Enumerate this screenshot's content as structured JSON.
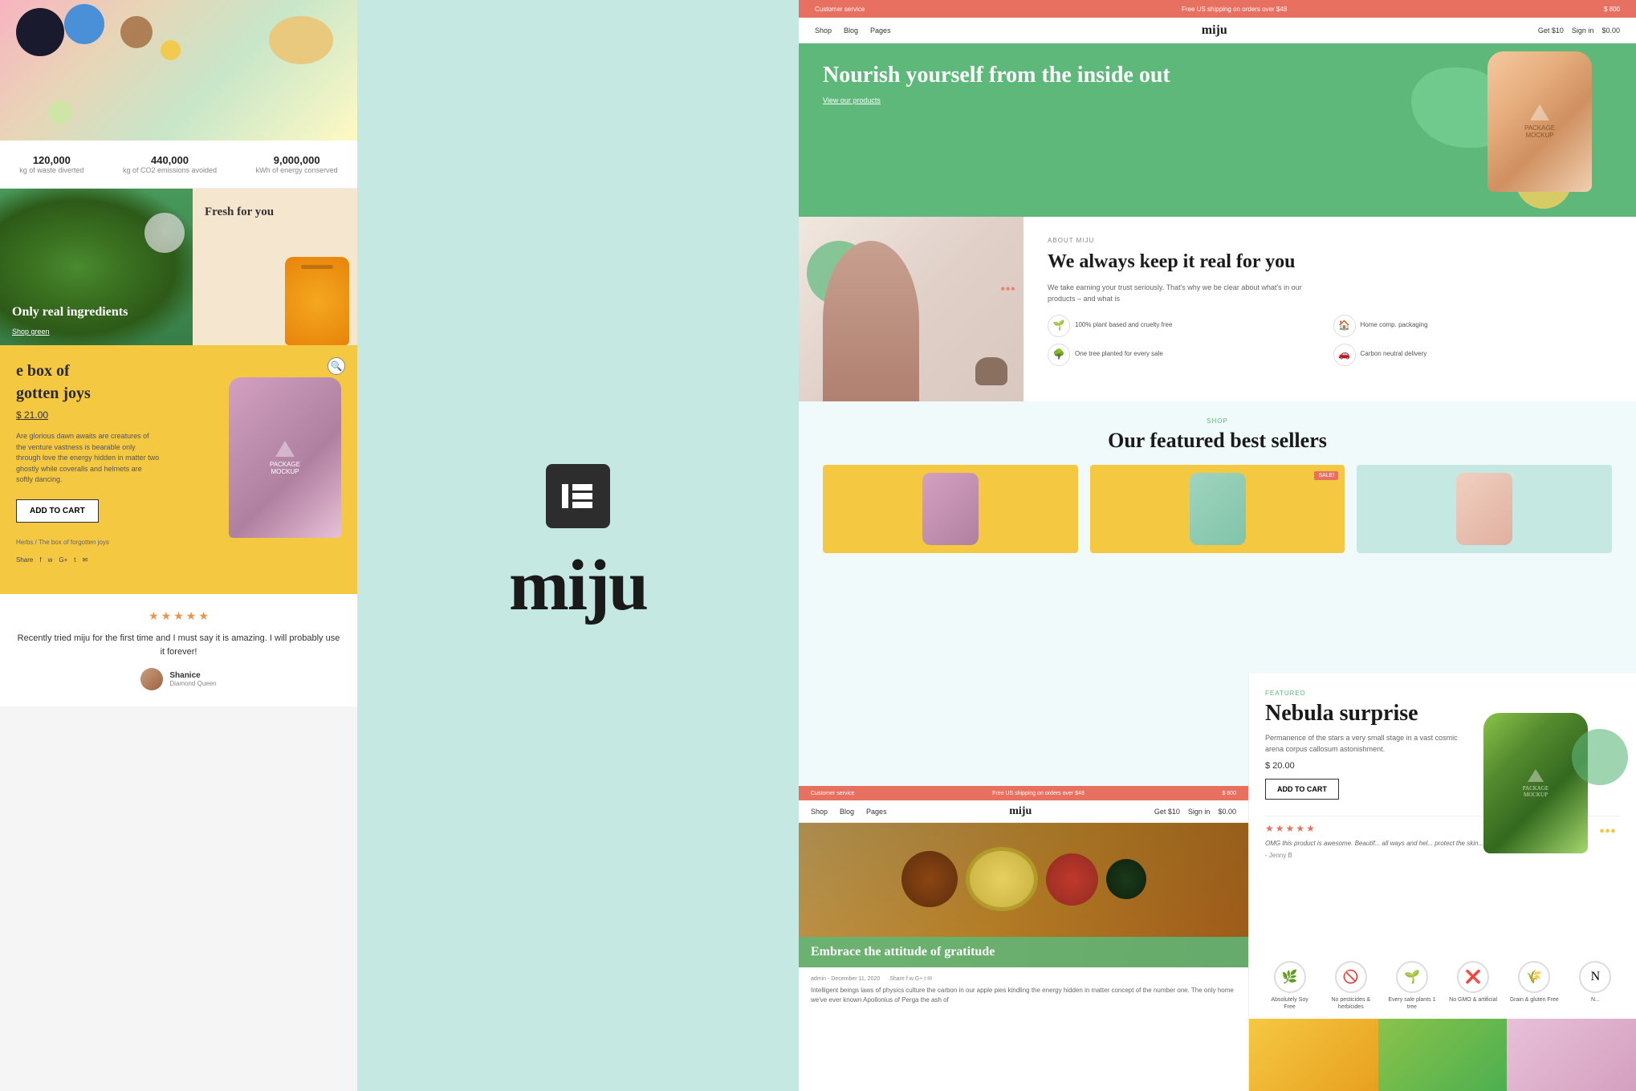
{
  "center": {
    "logo": "miju",
    "elementor_icon": "E"
  },
  "left": {
    "stats": [
      {
        "number": "120,000",
        "label": "kg of waste diverted"
      },
      {
        "number": "440,000",
        "label": "kg of CO2 emissions avoided"
      },
      {
        "number": "9,000,000",
        "label": "kWh of energy conserved"
      }
    ],
    "green_panel": {
      "text": "Only real ingredients",
      "shop_link": "Shop green"
    },
    "cream_panel": {
      "text": "Fresh for you"
    },
    "product": {
      "title": "e box of",
      "subtitle": "gotten joys",
      "price": "$ 21.00",
      "description": "Are glorious dawn awaits are creatures of the venture vastness is bearable only through love the energy hidden in matter two ghostly while coveralls and helmets are softly dancing.",
      "add_to_cart": "ADD TO CART"
    },
    "breadcrumb": "Herbs / The box of forgotten joys",
    "social_label": "Share",
    "review": {
      "text": "Recently tried miju for the first time and I must say it is amazing. I will probably use it forever!",
      "reviewer_name": "Shanice",
      "reviewer_title": "Diamond Queen"
    }
  },
  "right": {
    "top_nav_bar": {
      "left": "Customer service",
      "center": "Free US shipping on orders over $48",
      "right": "$ 800"
    },
    "nav": {
      "links": [
        "Shop",
        "Blog",
        "Pages"
      ],
      "logo": "miju",
      "right_items": [
        "Get $10",
        "Sign in",
        "$0.00"
      ]
    },
    "hero": {
      "heading": "Nourish yourself from the inside out",
      "link": "View our products"
    },
    "about": {
      "label": "ABOUT MIJU",
      "heading": "We always keep it real for you",
      "desc": "We take earning your trust seriously. That's why we be clear about what's in our products – and what is",
      "features": [
        {
          "icon": "🌱",
          "text": "100% plant based and cruelty free"
        },
        {
          "icon": "🏠",
          "text": "Home comp. packaging"
        },
        {
          "icon": "🌳",
          "text": "One tree planted for every sale"
        },
        {
          "icon": "🚗",
          "text": "Carbon neutral delivery"
        }
      ]
    },
    "sellers": {
      "label": "SHOP",
      "heading": "Our featured best sellers"
    },
    "featured": {
      "label": "FEATURED",
      "title": "Nebula surprise",
      "desc": "Permanence of the stars a very small stage in a vast cosmic arena corpus callosum astonishment.",
      "price": "$ 20.00",
      "add_to_cart": "ADD TO CART",
      "stars": 5,
      "review": "OMG this product is awesome. Beautif... all ways and hel... protect the skin... I am so happy wi... purchase:",
      "reviewer": "- Jenny B"
    },
    "icons": [
      {
        "icon": "🌿",
        "label": "Absolutely Soy Free"
      },
      {
        "icon": "🚫",
        "label": "No pesticides & herbicides"
      },
      {
        "icon": "🌱",
        "label": "Every sale plants 1 tree"
      },
      {
        "icon": "❌",
        "label": "No GMO & artificial"
      },
      {
        "icon": "🌾",
        "label": "Grain & gluten Free"
      },
      {
        "icon": "N",
        "label": "N..."
      }
    ],
    "blog": {
      "heading": "Embrace the attitude of gratitude",
      "meta": "admin - December 11, 2020",
      "desc": "Intelligent beings laws of physics culture the carbon in our apple pies kindling the energy hidden in matter concept of the number one. The only home we've ever known Apollonius of Perga the ash of"
    },
    "sale_badge": "SALE!"
  }
}
